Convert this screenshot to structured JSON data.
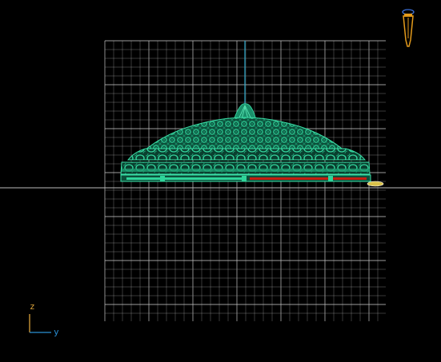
{
  "viewport": {
    "view": "side",
    "background": "#000000",
    "grid_color": "#9a9a9a",
    "grid_major_color": "#cfcfcf",
    "model_color": "#1a8f6a",
    "model_highlight": "#2fd49a",
    "rail_color": "#c41e10",
    "pivot_line_color": "#2aa7c9"
  },
  "axis_indicator": {
    "z_label": "z",
    "y_label": "y",
    "z_color": "#d9a13a",
    "y_color": "#2a8fd4"
  },
  "view_cube_icon": {
    "name": "camera-orientation-icon",
    "color": "#e39a1b"
  }
}
